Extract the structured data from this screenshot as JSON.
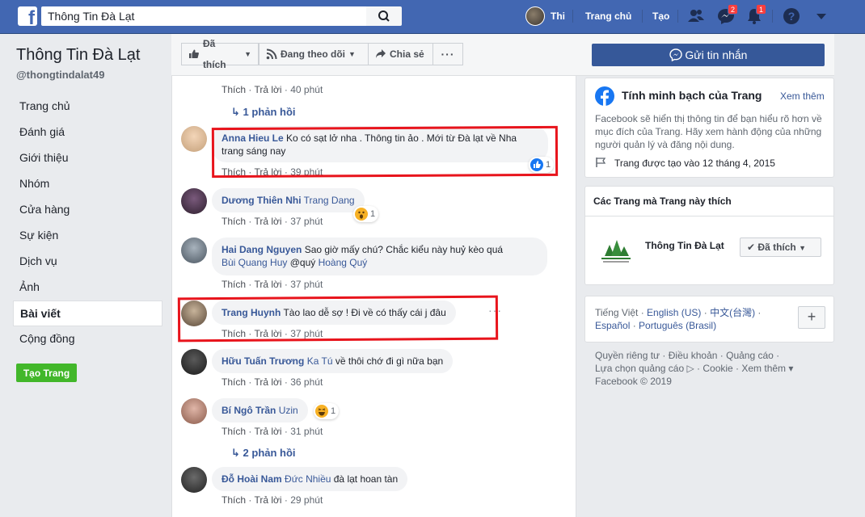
{
  "topbar": {
    "search_value": "Thông Tin Đà Lạt",
    "user_name": "Thi",
    "home": "Trang chủ",
    "create": "Tạo",
    "messages_badge": "2",
    "notifications_badge": "1"
  },
  "sidebar": {
    "page_name": "Thông Tin Đà Lạt",
    "handle": "@thongtindalat49",
    "items": [
      {
        "label": "Trang chủ"
      },
      {
        "label": "Đánh giá"
      },
      {
        "label": "Giới thiệu"
      },
      {
        "label": "Nhóm"
      },
      {
        "label": "Cửa hàng"
      },
      {
        "label": "Sự kiện"
      },
      {
        "label": "Dịch vụ"
      },
      {
        "label": "Ảnh"
      },
      {
        "label": "Bài viết"
      },
      {
        "label": "Cộng đồng"
      }
    ],
    "create_page": "Tạo Trang"
  },
  "action_bar": {
    "liked": "Đã thích",
    "following": "Đang theo dõi",
    "share": "Chia sẻ",
    "more": "...",
    "send_message": "Gửi tin nhắn"
  },
  "comments": {
    "like": "Thích",
    "reply": "Trả lời",
    "c0": {
      "time": "40 phút",
      "replies": "1 phản hồi"
    },
    "c1": {
      "author": "Anna Hieu Le",
      "text1": " Ko có sạt lở nha . Thông tin ảo . Mới từ Đà lạt về Nha",
      "text2": "trang sáng nay",
      "time": "39 phút",
      "react_count": "1"
    },
    "c2": {
      "author": "Dương Thiên Nhi",
      "mention": "Trang Dang",
      "time": "37 phút",
      "react_count": "1"
    },
    "c3": {
      "author": "Hai Dang Nguyen",
      "text1": " Sao giờ mấy chú? Chắc kiểu này huỷ kèo quá",
      "mention1": "Bùi Quang Huy",
      "text2": " @quý ",
      "mention2": "Hoàng Quý",
      "time": "37 phút"
    },
    "c4": {
      "author": "Trang Huynh",
      "text": " Tào lao dễ sợ ! Đi về có thấy cái j đâu",
      "time": "37 phút"
    },
    "c5": {
      "author": "Hữu Tuấn Trương",
      "mention": "Ka Tú",
      "text": " về thôi chớ đi gì nữa bạn",
      "time": "36 phút"
    },
    "c6": {
      "author": "Bí Ngô Trần",
      "mention": "Uzin",
      "time": "31 phút",
      "react_count": "1",
      "replies": "2 phản hồi"
    },
    "c7": {
      "author": "Đỗ Hoài Nam",
      "mention": "Đức Nhiều",
      "text": " đà lạt hoan tàn",
      "time": "29 phút"
    }
  },
  "transparency": {
    "title": "Tính minh bạch của Trang",
    "see_more": "Xem thêm",
    "desc": "Facebook sẽ hiển thị thông tin để bạn hiểu rõ hơn về mục đích của Trang. Hãy xem hành động của những người quản lý và đăng nội dung.",
    "created": "Trang được tạo vào 12 tháng 4, 2015"
  },
  "liked_pages": {
    "title": "Các Trang mà Trang này thích",
    "page_name": "Thông Tin Đà Lạt",
    "liked_btn": "Đã thích"
  },
  "languages": {
    "current": "Tiếng Việt",
    "l1": "English (US)",
    "l2": "中文(台灣)",
    "l3": "Español",
    "l4": "Português (Brasil)",
    "add": "+"
  },
  "footer": {
    "line1": "Quyền riêng tư · Điều khoản · Quảng cáo ·",
    "line2": "Lựa chọn quảng cáo ▷ · Cookie · Xem thêm ▾",
    "copyright": "Facebook © 2019"
  },
  "colors": {
    "brand": "#4267b2",
    "link": "#385898",
    "annotation_red": "#e8141c",
    "create_green": "#42b72a"
  }
}
